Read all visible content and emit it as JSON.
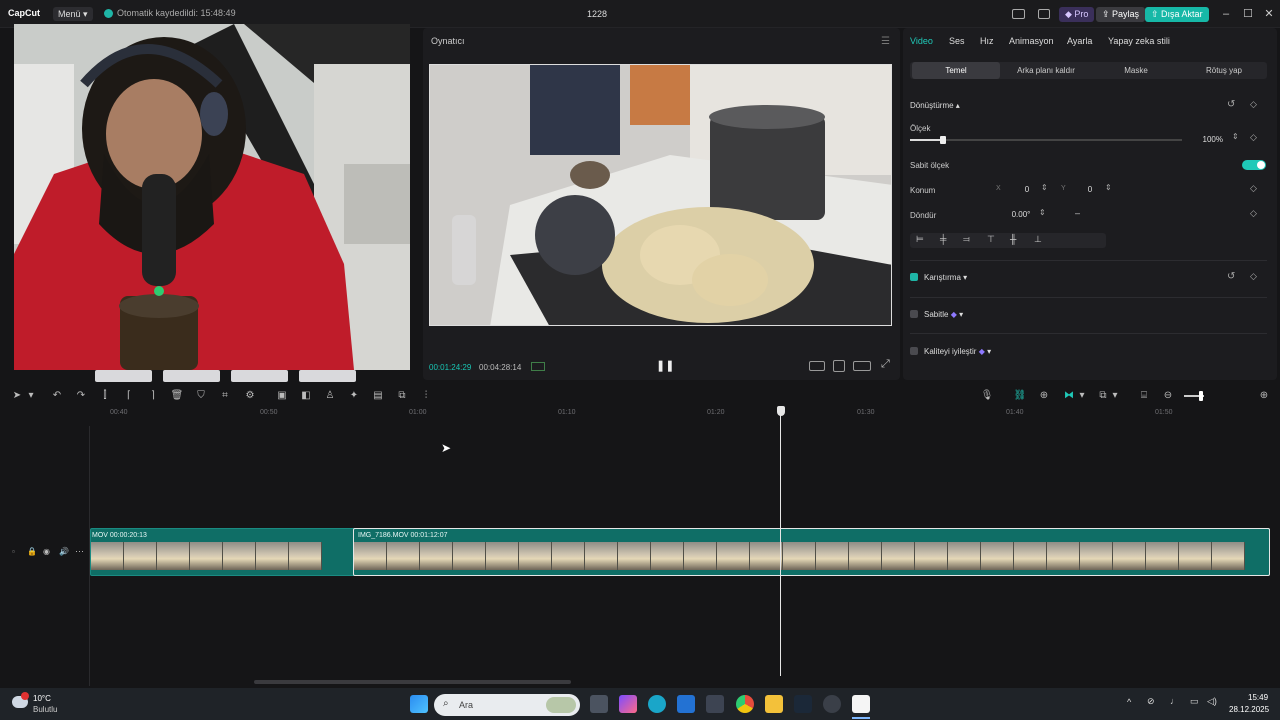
{
  "titlebar": {
    "logo": "CapCut",
    "menu_label": "Menü",
    "autosave": "Otomatik kaydedildi: 15:48:49",
    "project_title": "1228",
    "pro_label": "Pro",
    "share_label": "Paylaş",
    "export_label": "Dışa Aktar"
  },
  "player": {
    "title": "Oynatıcı",
    "current_time": "00:01:24:29",
    "duration": "00:04:28:14"
  },
  "props": {
    "tabs": [
      "Video",
      "Ses",
      "Hız",
      "Animasyon",
      "Ayarla",
      "Yapay zeka stili"
    ],
    "subtabs": [
      "Temel",
      "Arka planı kaldır",
      "Maske",
      "Rötuş yap"
    ],
    "transform_label": "Dönüştürme",
    "scale_label": "Ölçek",
    "scale_value": "100%",
    "scale_fraction": 0.12,
    "uniform_scale_label": "Sabit ölçek",
    "position_label": "Konum",
    "pos_x_label": "X",
    "pos_x": "0",
    "pos_y_label": "Y",
    "pos_y": "0",
    "rotate_label": "Döndür",
    "rotate_value": "0.00°",
    "blend_label": "Karıştırma",
    "stabilize_label": "Sabitle",
    "enhance_label": "Kaliteyi iyileştir",
    "accent": "#1fc9b8"
  },
  "timeline": {
    "ruler": [
      "00:40",
      "00:50",
      "01:00",
      "01:10",
      "01:20",
      "01:30",
      "01:40",
      "01:50"
    ],
    "clip1_label": "MOV  00:00:20:13",
    "clip2_label": "IMG_7186.MOV  00:01:12:07"
  },
  "taskbar": {
    "weather_temp": "10°C",
    "weather_desc": "Bulutlu",
    "search_placeholder": "Ara",
    "time": "15:49",
    "date": "28.12.2025"
  }
}
